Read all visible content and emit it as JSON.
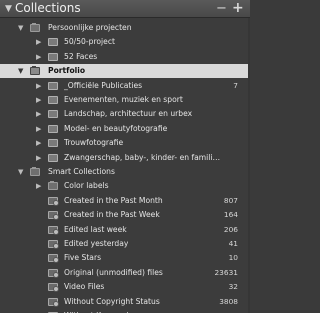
{
  "header": {
    "title": "Collections",
    "minus": "−",
    "plus": "+"
  },
  "groups": [
    {
      "label": "Persoonlijke projecten",
      "items": [
        {
          "label": "50/50-project",
          "count": ""
        },
        {
          "label": "52 Faces",
          "count": ""
        }
      ]
    },
    {
      "label": "Portfolio",
      "items": [
        {
          "label": "_Officiële Publicaties",
          "count": "7"
        },
        {
          "label": "Evenementen, muziek en sport",
          "count": ""
        },
        {
          "label": "Landschap, architectuur en urbex",
          "count": ""
        },
        {
          "label": "Model- en beautyfotografie",
          "count": ""
        },
        {
          "label": "Trouwfotografie",
          "count": ""
        },
        {
          "label": "Zwangerschap, baby-, kinder- en famili…",
          "count": ""
        }
      ]
    },
    {
      "label": "Smart Collections",
      "items": [
        {
          "label": "Color labels",
          "count": ""
        },
        {
          "label": "Created in the Past Month",
          "count": "807"
        },
        {
          "label": "Created in the Past Week",
          "count": "164"
        },
        {
          "label": "Edited last week",
          "count": "206"
        },
        {
          "label": "Edited yesterday",
          "count": "41"
        },
        {
          "label": "Five Stars",
          "count": "10"
        },
        {
          "label": "Original (unmodified) files",
          "count": "23631"
        },
        {
          "label": "Video Files",
          "count": "32"
        },
        {
          "label": "Without Copyright Status",
          "count": "3808"
        },
        {
          "label": "Without Keywords",
          "count": "20763"
        }
      ]
    }
  ],
  "icons": {
    "expanded": "triangle-down-icon",
    "collapsed": "triangle-right-icon",
    "folder": "collection-set-icon",
    "collection": "collection-icon",
    "smart": "smart-collection-icon"
  },
  "colors": {
    "background": "#3c3c3c",
    "selected": "#d9d9d9",
    "header": "#4f4f4f"
  }
}
